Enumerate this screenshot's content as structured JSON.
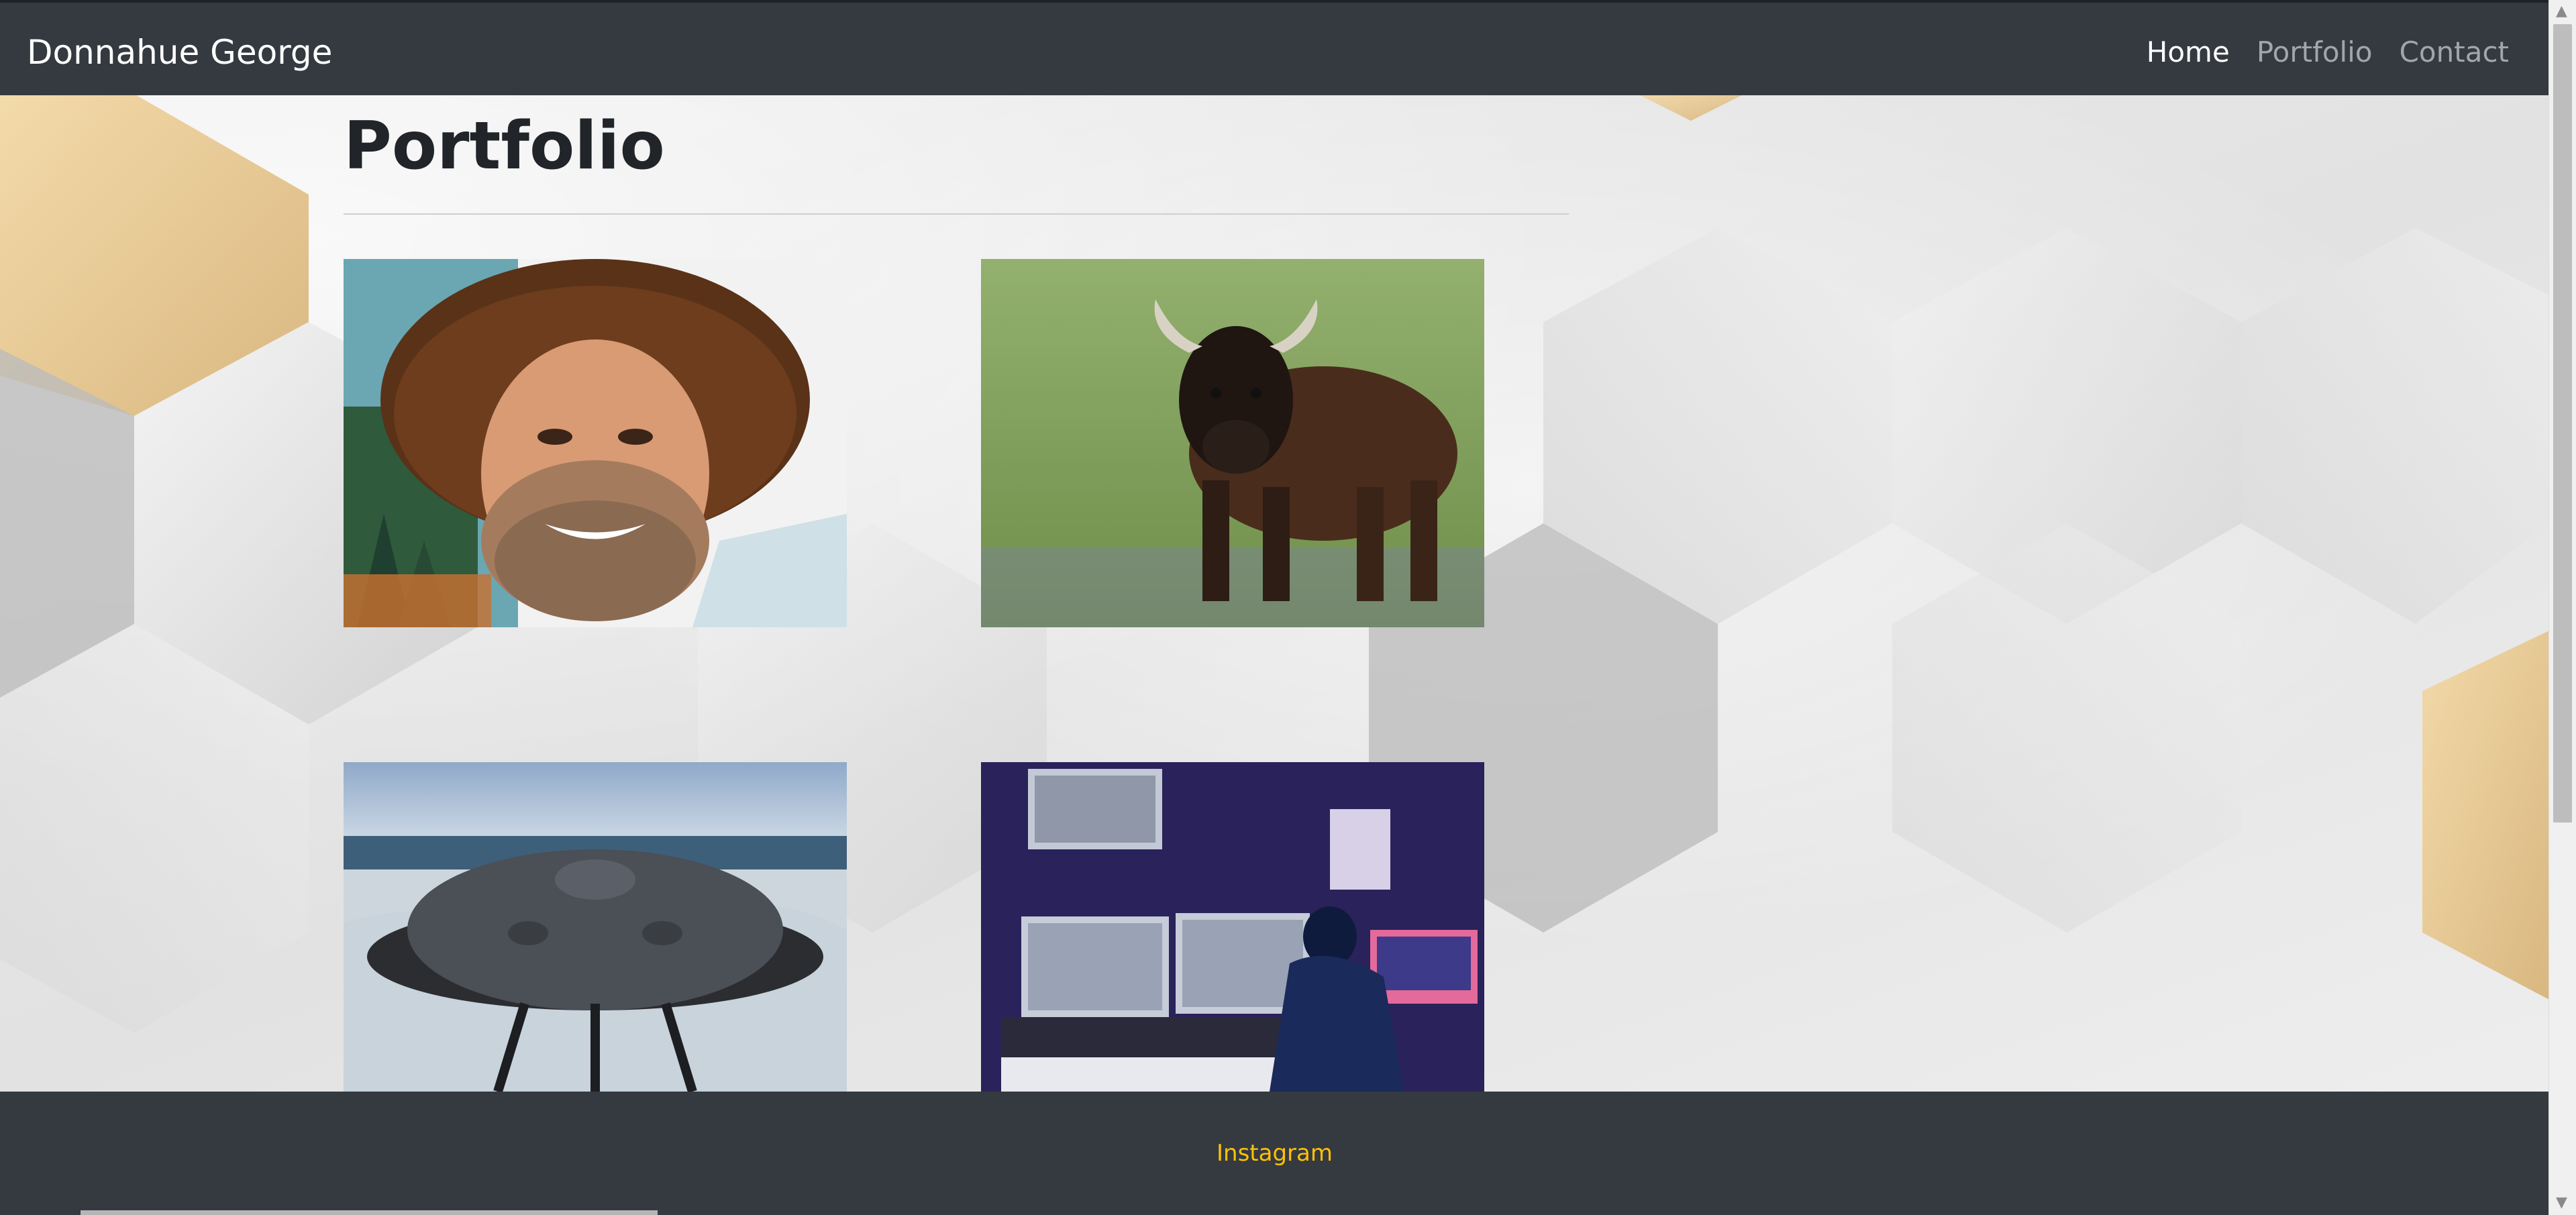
{
  "navbar": {
    "brand": "Donnahue George",
    "links": [
      {
        "label": "Home",
        "active": true
      },
      {
        "label": "Portfolio",
        "active": false
      },
      {
        "label": "Contact",
        "active": false
      }
    ]
  },
  "main": {
    "title": "Portfolio",
    "gallery": [
      {
        "subject": "portrait-curly-hair"
      },
      {
        "subject": "bull-in-meadow"
      },
      {
        "subject": "handpan-at-sea"
      },
      {
        "subject": "music-studio"
      }
    ]
  },
  "footer": {
    "link": "Instagram"
  },
  "colors": {
    "navbar_bg": "#343a40",
    "footer_link": "#ffc107",
    "title": "#212529"
  }
}
